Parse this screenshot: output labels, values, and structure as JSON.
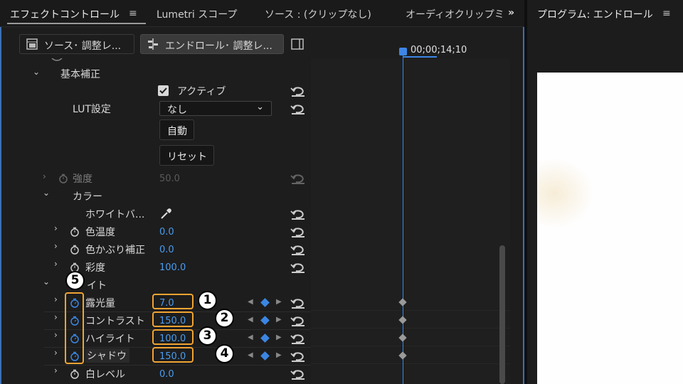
{
  "tabs": {
    "effect_controls": "エフェクトコントロール",
    "lumetri_scopes": "Lumetri スコープ",
    "source": "ソース : (クリップなし)",
    "audio_clip": "オーディオクリップミ",
    "program": "プログラム: エンドロール"
  },
  "clip_selector": {
    "source_clip": "ソース･ 調整レ...",
    "sequence_clip": "エンドロール･ 調整レ..."
  },
  "timecode": "00;00;14;10",
  "sections": {
    "basic_correction": "基本補正",
    "active_label": "アクティブ",
    "lut_label": "LUT設定",
    "lut_value": "なし",
    "auto_button": "自動",
    "reset_button": "リセット",
    "intensity_label": "強度",
    "intensity_value": "50.0",
    "color_label": "カラー",
    "white_balance_label": "ホワイトバ...",
    "color_temp_label": "色温度",
    "color_temp_value": "0.0",
    "tint_label": "色かぶり補正",
    "tint_value": "0.0",
    "saturation_label": "彩度",
    "saturation_value": "100.0",
    "light_label": "イト",
    "exposure_label": "露光量",
    "exposure_value": "7.0",
    "contrast_label": "コントラスト",
    "contrast_value": "150.0",
    "highlights_label": "ハイライト",
    "highlights_value": "100.0",
    "shadows_label": "シャドウ",
    "shadows_value": "150.0",
    "whites_label": "白レベル",
    "whites_value": "0.0"
  },
  "annotations": {
    "n1": "1",
    "n2": "2",
    "n3": "3",
    "n4": "4",
    "n5": "5",
    "highlight_color": "#f0a333"
  },
  "icons": [
    "menu-icon",
    "expand-icon",
    "sidebar-toggle-icon",
    "stopwatch-icon",
    "reset-icon",
    "eyedropper-icon",
    "keyframe-icon",
    "chevron-icon",
    "checkbox-icon"
  ],
  "colors": {
    "accent_blue": "#3d86e6",
    "value_blue": "#4a9cf0",
    "panel_bg": "#1d1d1d"
  }
}
